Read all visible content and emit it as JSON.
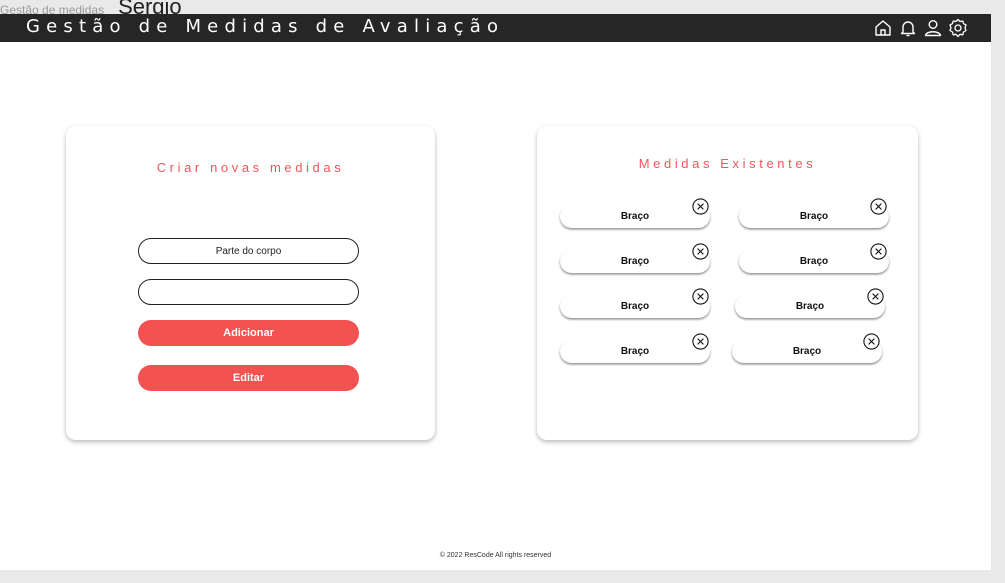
{
  "frame": {
    "label_small": "Gestão de medidas",
    "label_big": "Sergio"
  },
  "header": {
    "title": "Gestão de Medidas de Avaliação",
    "icons": [
      "home-icon",
      "bell-icon",
      "user-icon",
      "settings-icon"
    ]
  },
  "create_panel": {
    "title": "Criar novas medidas",
    "body_part_input": {
      "placeholder": "Parte do corpo",
      "value": ""
    },
    "second_input": {
      "placeholder": "",
      "value": ""
    },
    "add_label": "Adicionar",
    "edit_label": "Editar"
  },
  "existing_panel": {
    "title": "Medidas Existentes",
    "items": [
      {
        "label": "Braço"
      },
      {
        "label": "Braço"
      },
      {
        "label": "Braço"
      },
      {
        "label": "Braço"
      },
      {
        "label": "Braço"
      },
      {
        "label": "Braço"
      },
      {
        "label": "Braço"
      },
      {
        "label": "Braço"
      }
    ]
  },
  "footer": {
    "text": "© 2022 ResCode All rights reserved"
  },
  "colors": {
    "accent": "#f45151",
    "title_accent": "#f0555a",
    "topbar": "#262626",
    "background": "#e9e9e9"
  }
}
